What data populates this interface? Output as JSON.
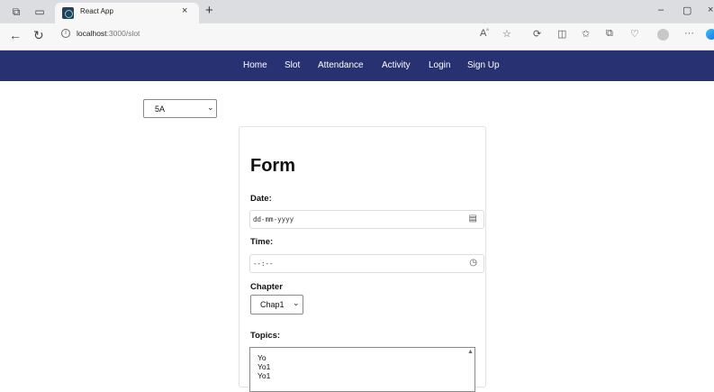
{
  "browser": {
    "tab_title": "React App",
    "tab_close": "×",
    "new_tab": "+",
    "url_host": "localhost",
    "url_rest": ":3000/slot",
    "window_controls": {
      "minimize": "–",
      "maximize": "▢",
      "close": "×"
    }
  },
  "nav": {
    "items": [
      {
        "label": "Home"
      },
      {
        "label": "Slot"
      },
      {
        "label": "Attendance"
      },
      {
        "label": "Activity"
      },
      {
        "label": "Login"
      },
      {
        "label": "Sign Up"
      }
    ]
  },
  "class_select": {
    "value": "5A"
  },
  "form": {
    "title": "Form",
    "date_label": "Date:",
    "date_placeholder": "dd-mm-yyyy",
    "time_label": "Time:",
    "time_placeholder": "--:--",
    "chapter_label": "Chapter",
    "chapter_value": "Chap1",
    "topics_label": "Topics:",
    "topics_options": [
      "Yo",
      "Yo1",
      "Yo1"
    ]
  },
  "colors": {
    "nav_bg": "#283272",
    "nav_text": "#ffffff",
    "chrome_bg": "#dcdde1"
  }
}
